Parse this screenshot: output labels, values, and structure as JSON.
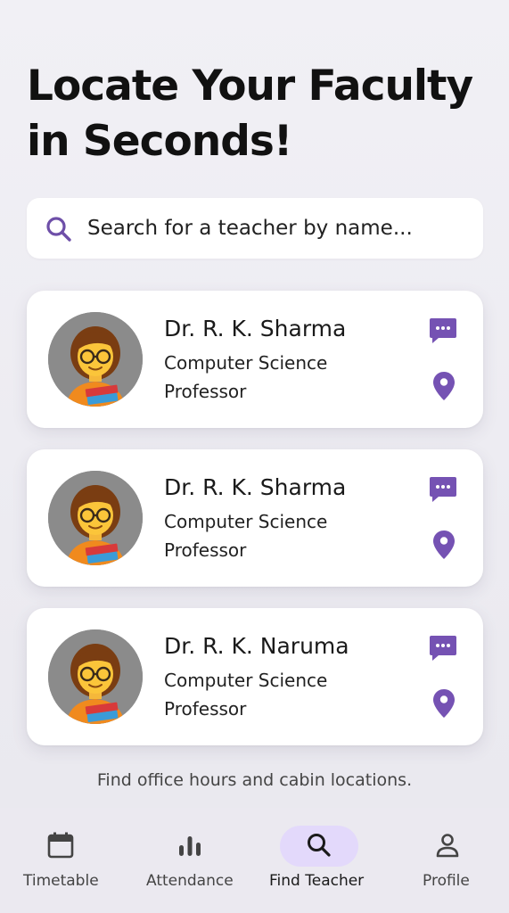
{
  "headline": {
    "line1": "Locate Your Faculty",
    "line2": "in Seconds!"
  },
  "search": {
    "placeholder": "Search for a teacher by name...",
    "icon": "search-icon"
  },
  "teachers": [
    {
      "name": "Dr. R. K. Sharma",
      "department": "Computer Science",
      "role": "Professor"
    },
    {
      "name": "Dr. R. K. Sharma",
      "department": "Computer Science",
      "role": "Professor"
    },
    {
      "name": "Dr. R. K. Naruma",
      "department": "Computer Science",
      "role": "Professor"
    }
  ],
  "footer_note": "Find office hours and cabin locations.",
  "bottom_nav": [
    {
      "label": "Timetable",
      "icon": "calendar-icon",
      "active": false
    },
    {
      "label": "Attendance",
      "icon": "bar-chart-icon",
      "active": false
    },
    {
      "label": "Find Teacher",
      "icon": "search-icon",
      "active": true
    },
    {
      "label": "Profile",
      "icon": "person-icon",
      "active": false
    }
  ],
  "colors": {
    "accent": "#6e4fa8",
    "active_pill": "#e3d9fb",
    "background": "#efeef3"
  }
}
